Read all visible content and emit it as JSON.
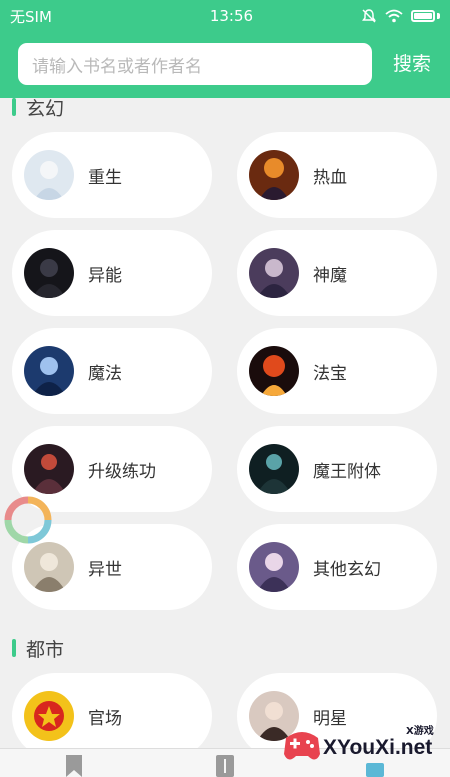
{
  "status_bar": {
    "carrier": "无SIM",
    "time": "13:56"
  },
  "search": {
    "placeholder": "请输入书名或者作者名",
    "button_label": "搜索"
  },
  "sections": [
    {
      "title": "玄幻",
      "items": [
        "重生",
        "热血",
        "异能",
        "神魔",
        "魔法",
        "法宝",
        "升级练功",
        "魔王附体",
        "异世",
        "其他玄幻"
      ]
    },
    {
      "title": "都市",
      "items": [
        "官场",
        "明星"
      ]
    }
  ],
  "watermark": {
    "text": "XYouXi.net",
    "small": "X游戏"
  },
  "colors": {
    "accent": "#3dcb8b",
    "background": "#f0f0f0",
    "card": "#ffffff"
  }
}
